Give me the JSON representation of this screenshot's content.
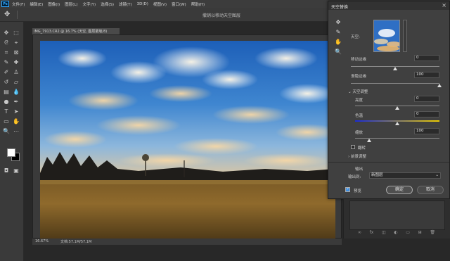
{
  "app": {
    "logo": "Ps"
  },
  "menu": [
    "文件(F)",
    "编辑(E)",
    "图像(I)",
    "图层(L)",
    "文字(Y)",
    "选择(S)",
    "滤镜(T)",
    "3D(D)",
    "视图(V)",
    "窗口(W)",
    "帮助(H)"
  ],
  "options_bar": {
    "title": "撤销以移动天空图层"
  },
  "document": {
    "tab_label": "IMG_7913.CR2 @ 16.7% (天空, 图层蒙版/8)",
    "zoom": "16.67%",
    "doc_info": "文档:57.1M/57.1M"
  },
  "dialog": {
    "title": "天空替换",
    "sky_label": "天空:",
    "shift_edge": {
      "label": "移动边缘",
      "value": "0",
      "fraction": 0.5
    },
    "fade_edge": {
      "label": "渐隐边缘",
      "value": "100",
      "fraction": 1.0
    },
    "sky_adjust": {
      "section_label": "天空调整",
      "brightness": {
        "label": "亮度",
        "value": "0",
        "fraction": 0.5
      },
      "temperature": {
        "label": "色温",
        "value": "0",
        "fraction": 0.5
      },
      "scale": {
        "label": "缩放",
        "value": "100",
        "fraction": 0.17
      },
      "flip_label": "翻转"
    },
    "foreground_section_label": "前景调整",
    "output_label": "输出",
    "output_to_label": "输出到:",
    "output_to_value": "新图层",
    "preview_label": "预览",
    "ok_label": "确定",
    "cancel_label": "取消"
  },
  "colors": {
    "accent": "#31a8ff",
    "temp_cold": "#1a2bd8",
    "temp_warm": "#f0d000"
  },
  "icons": [
    "move-icon",
    "hand-icon",
    "zoom-icon",
    "sky-brush-icon"
  ]
}
